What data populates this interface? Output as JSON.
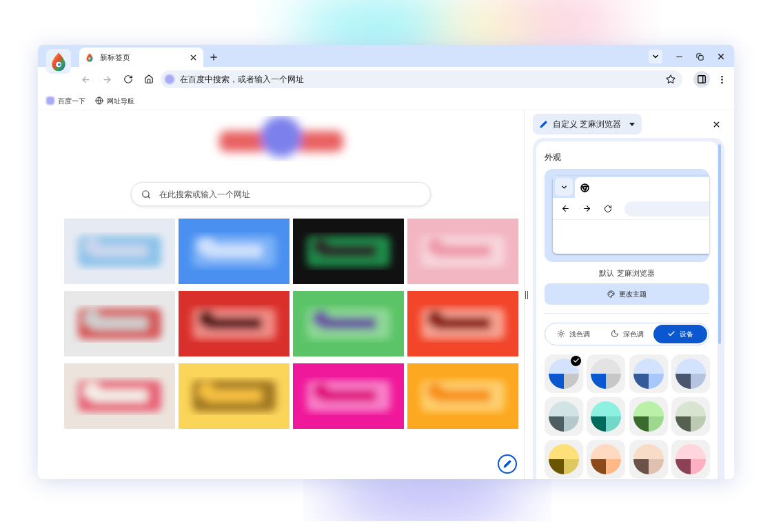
{
  "window": {
    "tabs": [
      {
        "title": "新标签页",
        "selected": true
      }
    ]
  },
  "toolbar": {
    "address_placeholder": "在百度中搜索，或者输入一个网址",
    "side_panel_open": true
  },
  "bookmarks": [
    {
      "label": "百度一下",
      "kind": "site"
    },
    {
      "label": "网址导航",
      "kind": "globe"
    }
  ],
  "new_tab_page": {
    "search_placeholder": "在此搜索或输入一个网址"
  },
  "side_panel": {
    "title": "自定义 芝麻浏览器",
    "section": "外观",
    "theme_name": "默认 芝麻浏览器",
    "change_theme": "更改主题",
    "modes": [
      {
        "label": "浅色调",
        "kind": "light",
        "selected": false
      },
      {
        "label": "深色调",
        "kind": "dark",
        "selected": false
      },
      {
        "label": "设备",
        "kind": "device",
        "selected": true
      }
    ],
    "swatches": [
      {
        "selected": true,
        "segments": [
          {
            "color": "#d3e3fd"
          },
          {
            "color": "#0b57d0"
          },
          {
            "color": "#c7c7c7"
          }
        ]
      },
      {
        "selected": false,
        "segments": [
          {
            "color": "#e3e3e3"
          },
          {
            "color": "#0b57d0"
          },
          {
            "color": "#c7c7c7"
          }
        ]
      },
      {
        "selected": false,
        "segments": [
          {
            "color": "#d3e3fd"
          },
          {
            "color": "#345a9a"
          },
          {
            "color": "#a8c7fa"
          }
        ]
      },
      {
        "selected": false,
        "segments": [
          {
            "color": "#d3e3fd"
          },
          {
            "color": "#4b566e"
          },
          {
            "color": "#b6c4e0"
          }
        ]
      },
      {
        "selected": false,
        "segments": [
          {
            "color": "#d2e3e6"
          },
          {
            "color": "#4f5e63"
          },
          {
            "color": "#b5c9cc"
          }
        ]
      },
      {
        "selected": false,
        "segments": [
          {
            "color": "#8ef0e0"
          },
          {
            "color": "#006a5c"
          },
          {
            "color": "#72d8c8"
          }
        ]
      },
      {
        "selected": false,
        "segments": [
          {
            "color": "#bbf0a8"
          },
          {
            "color": "#3a6b2e"
          },
          {
            "color": "#9ed88e"
          }
        ]
      },
      {
        "selected": false,
        "segments": [
          {
            "color": "#d8e4d0"
          },
          {
            "color": "#556050"
          },
          {
            "color": "#bccab4"
          }
        ]
      },
      {
        "selected": false,
        "segments": [
          {
            "color": "#fde07a"
          },
          {
            "color": "#6b5600"
          },
          {
            "color": "#e0c860"
          }
        ]
      },
      {
        "selected": false,
        "segments": [
          {
            "color": "#ffd9c0"
          },
          {
            "color": "#8b4a1c"
          },
          {
            "color": "#ffb888"
          }
        ]
      },
      {
        "selected": false,
        "segments": [
          {
            "color": "#f9dcc8"
          },
          {
            "color": "#6b5248"
          },
          {
            "color": "#e0c0b0"
          }
        ]
      },
      {
        "selected": false,
        "segments": [
          {
            "color": "#ffd6de"
          },
          {
            "color": "#8b4256"
          },
          {
            "color": "#ffb0c0"
          }
        ]
      }
    ]
  }
}
